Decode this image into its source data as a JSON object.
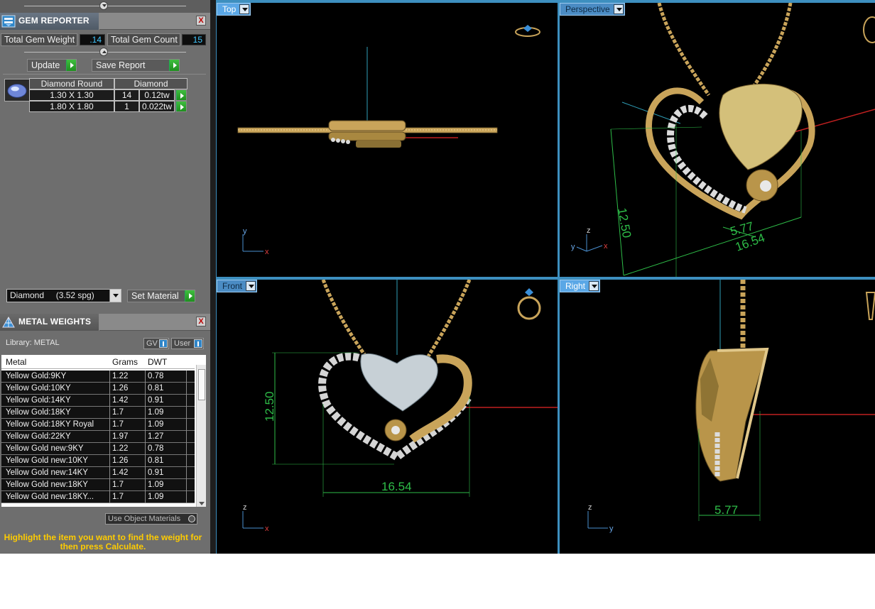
{
  "gem_reporter": {
    "title": "GEM REPORTER",
    "close": "X",
    "total_weight_label": "Total Gem Weight",
    "total_weight_value": ".14",
    "total_count_label": "Total Gem Count",
    "total_count_value": "15",
    "update_label": "Update",
    "save_report_label": "Save Report",
    "table_headers": [
      "Diamond Round",
      "Diamond"
    ],
    "rows": [
      {
        "size": "1.30 X 1.30",
        "count": "14",
        "weight": "0.12tw"
      },
      {
        "size": "1.80 X 1.80",
        "count": "1",
        "weight": "0.022tw"
      }
    ],
    "material_select_value": "Diamond     (3.52 spg)",
    "set_material_label": "Set Material"
  },
  "metal_weights": {
    "title": "METAL WEIGHTS",
    "close": "X",
    "library_label": "Library: METAL",
    "gv_label": "GV",
    "user_label": "User",
    "headers": [
      "Metal",
      "Grams",
      "DWT"
    ],
    "rows": [
      {
        "metal": "Yellow Gold:9KY",
        "grams": "1.22",
        "dwt": "0.78"
      },
      {
        "metal": "Yellow Gold:10KY",
        "grams": "1.26",
        "dwt": "0.81"
      },
      {
        "metal": "Yellow Gold:14KY",
        "grams": "1.42",
        "dwt": "0.91"
      },
      {
        "metal": "Yellow Gold:18KY",
        "grams": "1.7",
        "dwt": "1.09"
      },
      {
        "metal": "Yellow Gold:18KY Royal",
        "grams": "1.7",
        "dwt": "1.09"
      },
      {
        "metal": "Yellow Gold:22KY",
        "grams": "1.97",
        "dwt": "1.27"
      },
      {
        "metal": "Yellow Gold new:9KY",
        "grams": "1.22",
        "dwt": "0.78"
      },
      {
        "metal": "Yellow Gold new:10KY",
        "grams": "1.26",
        "dwt": "0.81"
      },
      {
        "metal": "Yellow Gold new:14KY",
        "grams": "1.42",
        "dwt": "0.91"
      },
      {
        "metal": "Yellow Gold new:18KY",
        "grams": "1.7",
        "dwt": "1.09"
      },
      {
        "metal": "Yellow Gold new:18KY...",
        "grams": "1.7",
        "dwt": "1.09"
      }
    ],
    "use_object_materials_label": "Use Object Materials",
    "hint": "Highlight the item you want to find the weight for then press Calculate."
  },
  "viewports": {
    "top": {
      "label": "Top",
      "axis_h": "x",
      "axis_v": "y"
    },
    "perspective": {
      "label": "Perspective",
      "axis_a": "y",
      "axis_b": "x",
      "axis_c": "z",
      "dim_height": "12.50",
      "dim_depth": "5.77",
      "dim_width": "16.54"
    },
    "front": {
      "label": "Front",
      "axis_h": "x",
      "axis_v": "z",
      "dim_height": "12.50",
      "dim_width": "16.54"
    },
    "right": {
      "label": "Right",
      "axis_h": "y",
      "axis_v": "z",
      "dim_depth": "5.77"
    }
  },
  "colors": {
    "gold": "#c9a45a",
    "dimension_green": "#2ebd48",
    "viewport_tab": "#4b8cc4",
    "hint_yellow": "#ffcc00"
  }
}
